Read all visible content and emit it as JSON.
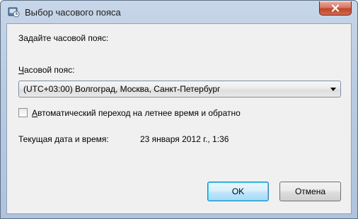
{
  "window": {
    "title": "Выбор часового пояса",
    "icon": "clock-globe-icon",
    "close_icon": "close-icon"
  },
  "content": {
    "prompt": "Задайте часовой пояс:",
    "timezone_label": "Часовой пояс:",
    "timezone_selected": "(UTC+03:00) Волгоград, Москва, Санкт-Петербург",
    "dst_checkbox_label": "Автоматический переход на летнее время и обратно",
    "dst_checked": false,
    "current_datetime_label": "Текущая дата и время:",
    "current_datetime_value": "23 января 2012 г., 1:36"
  },
  "buttons": {
    "ok": "OK",
    "cancel": "Отмена"
  },
  "colors": {
    "accent": "#3c7fb1",
    "close": "#c1442c"
  }
}
